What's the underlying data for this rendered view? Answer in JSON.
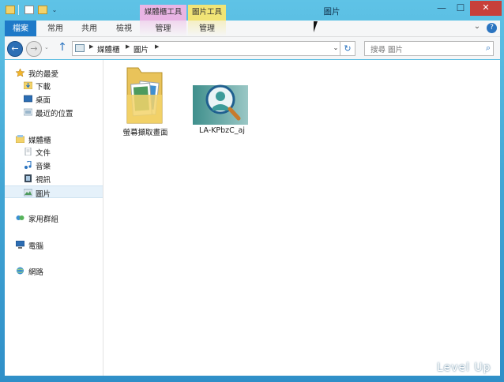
{
  "titlebar": {
    "title": "圖片",
    "context_tabs": {
      "media_tools": "媒體櫃工具",
      "picture_tools": "圖片工具"
    },
    "minimize": "—",
    "maximize": "☐",
    "close": "✕"
  },
  "ribbon": {
    "tabs": [
      "檔案",
      "常用",
      "共用",
      "檢視",
      "管理",
      "管理"
    ],
    "expand_glyph": "⌄",
    "help_glyph": "?"
  },
  "nav": {
    "back_glyph": "←",
    "forward_glyph": "→",
    "up_glyph": "↑",
    "refresh_glyph": "↻",
    "dropdown_glyph": "⌄",
    "separator_glyph": "▶",
    "breadcrumbs": [
      "媒體櫃",
      "圖片"
    ],
    "search_placeholder": "搜尋 圖片",
    "search_glyph": "⌕"
  },
  "sidebar": {
    "favorites": {
      "label": "我的最愛",
      "items": [
        "下載",
        "桌面",
        "最近的位置"
      ]
    },
    "libraries": {
      "label": "媒體櫃",
      "items": [
        "文件",
        "音樂",
        "視訊",
        "圖片"
      ],
      "selected": "圖片"
    },
    "homegroup": "家用群組",
    "computer": "電腦",
    "network": "網路"
  },
  "files": [
    {
      "name": "螢幕擷取畫面",
      "icon": "folder-icon"
    },
    {
      "name": "LA-KPbzC_aj",
      "icon": "image-file-icon"
    }
  ],
  "watermark": "Level Up",
  "colors": {
    "accent": "#1e79c8",
    "selection": "#e5f1fa",
    "close": "#c7403a"
  }
}
